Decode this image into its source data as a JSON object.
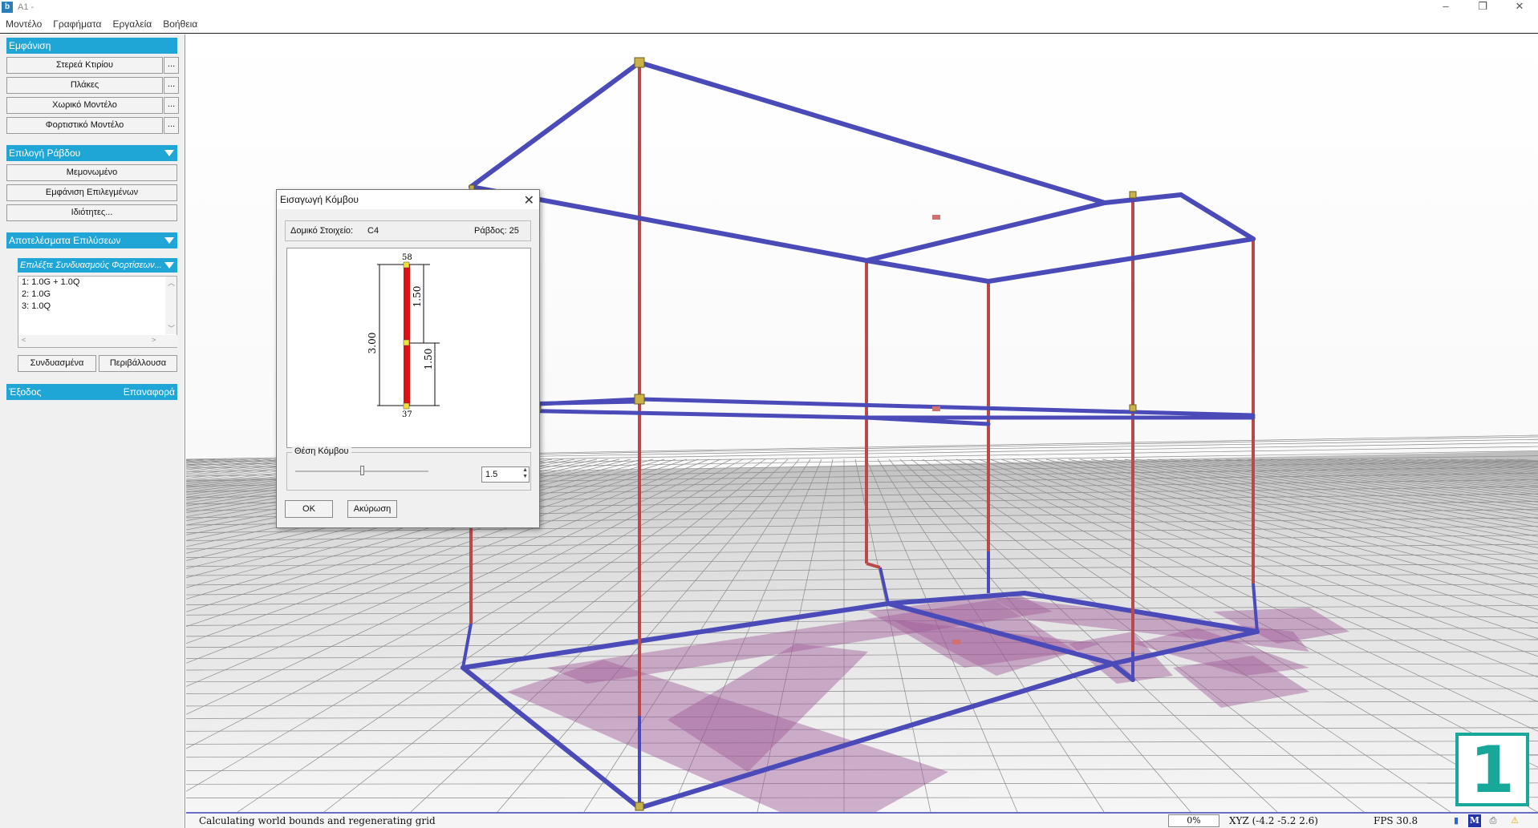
{
  "window": {
    "title": "A1 -",
    "icon": "app-icon",
    "min": "–",
    "max": "❐",
    "close": "✕"
  },
  "menu": [
    "Μοντέλο",
    "Γραφήματα",
    "Εργαλεία",
    "Βοήθεια"
  ],
  "panel": {
    "display_header": "Εμφάνιση",
    "display_buttons": [
      "Στερεά Κτιρίου",
      "Πλάκες",
      "Χωρικό Μοντέλο",
      "Φορτιστικό Μοντέλο"
    ],
    "more": "...",
    "select_header": "Επιλογή Ράβδου",
    "select_buttons": [
      "Μεμονωμένο",
      "Εμφάνιση Επιλεγμένων",
      "Ιδιότητες..."
    ],
    "results_header": "Αποτελέσματα Επιλύσεων",
    "combo_label": "Επιλέξτε Συνδυασμούς Φορτίσεων...",
    "combinations": [
      "1: 1.0G + 1.0Q",
      "2: 1.0G",
      "3: 1.0Q"
    ],
    "combined_button": "Συνδυασμένα",
    "envelope_button": "Περιβάλλουσα",
    "exit_label": "Έξοδος",
    "restore_label": "Επαναφορά"
  },
  "dialog": {
    "title": "Εισαγωγή Κόμβου",
    "element_label": "Δομικό Στοιχείο:",
    "element_value": "C4",
    "bar_label": "Ράβδος: 25",
    "node_top": "58",
    "node_bottom": "37",
    "dim_total": "3.00",
    "dim_upper": "1.50",
    "dim_lower": "1.50",
    "position_group": "Θέση Κόμβου",
    "position_value": "1.5",
    "position_fraction": 0.5,
    "ok": "OK",
    "cancel": "Ακύρωση"
  },
  "status": {
    "message": "Calculating world bounds and regenerating grid",
    "progress": "0%",
    "coords": "XYZ (-4.2 -5.2 2.6)",
    "fps": "FPS  30.8",
    "icons": [
      "db-icon",
      "m-icon",
      "printer-icon",
      "warning-icon"
    ]
  },
  "badge": "1",
  "colors": {
    "accent": "#1fa6d6",
    "beam": "#4a4ab8",
    "column": "#b84a4a",
    "selected": "#22cc22",
    "footing": "#a05a9a"
  }
}
